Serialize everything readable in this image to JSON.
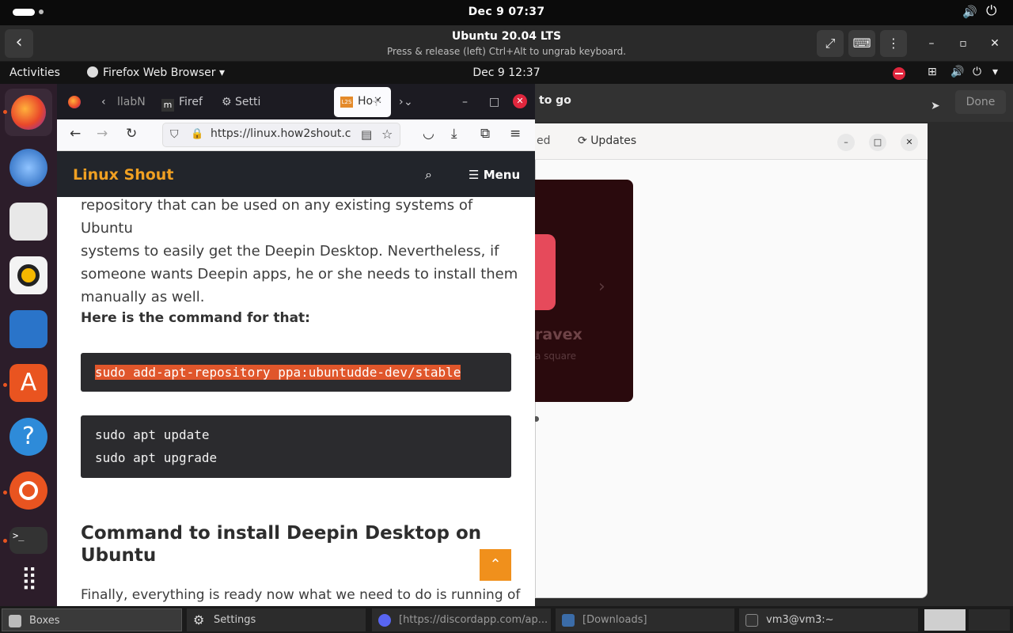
{
  "host": {
    "clock": "Dec 9  07:37"
  },
  "boxes": {
    "title": "Ubuntu 20.04 LTS",
    "subtitle": "Press & release (left) Ctrl+Alt to ungrab keyboard."
  },
  "guest_panel": {
    "activities": "Activities",
    "app_menu": "Firefox Web Browser",
    "clock": "Dec 9  12:37"
  },
  "dock": {
    "items": [
      "firefox",
      "thunderbird",
      "files",
      "rhythmbox",
      "libreoffice-writer",
      "ubuntu-software",
      "help",
      "ubuntu",
      "terminal",
      "show-apps"
    ]
  },
  "background_app": {
    "header_title": "to go",
    "done_label": "Done",
    "tab_partial": "ed",
    "updates_tab": "Updates",
    "banner_name": "ravex",
    "banner_sub": "a square"
  },
  "firefox": {
    "tabs": [
      {
        "label": "llabN"
      },
      {
        "label": "Firef"
      },
      {
        "label": "Setti"
      },
      {
        "label": "Ho",
        "active": true
      }
    ],
    "url": "https://linux.how2shout.c"
  },
  "page": {
    "site_title": "Linux Shout",
    "menu_label": "Menu",
    "para1_lines": [
      "repository that can be used on any existing systems of Ubuntu",
      "systems to easily get the Deepin Desktop. Nevertheless, if",
      "someone wants Deepin apps, he or she needs to install them",
      "manually as well."
    ],
    "command_intro": "Here is the command for that:",
    "code1": "sudo add-apt-repository ppa:ubuntudde-dev/stable",
    "code2_lines": [
      "sudo apt update",
      "sudo apt upgrade"
    ],
    "heading_lines": [
      "Command to install Deepin Desktop on",
      "Ubuntu"
    ],
    "para2": "Finally, everything is ready now what we need to do is running of"
  },
  "taskbar": {
    "items": [
      {
        "label": "Boxes"
      },
      {
        "label": "Settings"
      },
      {
        "label": "[https://discordapp.com/ap..."
      },
      {
        "label": "[Downloads]"
      },
      {
        "label": "vm3@vm3:~"
      }
    ]
  },
  "colors": {
    "accent": "#e95420",
    "site_title": "#f0a022",
    "highlight": "#e0562b"
  }
}
